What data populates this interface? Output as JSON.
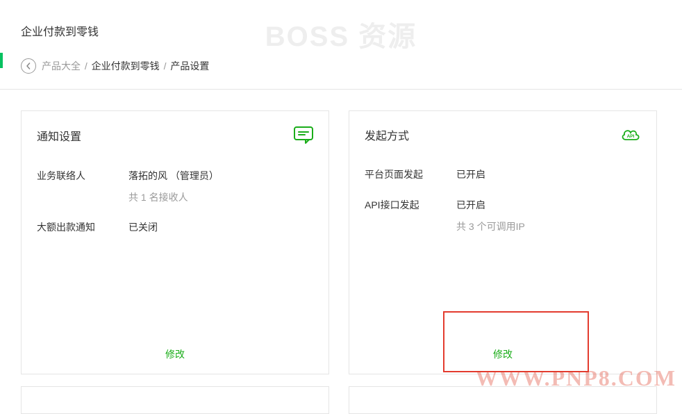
{
  "page_title": "企业付款到零钱",
  "breadcrumb": {
    "root": "产品大全",
    "mid": "企业付款到零钱",
    "current": "产品设置",
    "sep": "/"
  },
  "watermark": "BOSS 资源",
  "url_watermark": "WWW.PNP8.COM",
  "cards": {
    "notify": {
      "title": "通知设置",
      "contact_label": "业务联络人",
      "contact_value": "落拓的风 （管理员）",
      "contact_sub": "共 1 名接收人",
      "large_label": "大额出款通知",
      "large_value": "已关闭",
      "modify": "修改"
    },
    "initiate": {
      "title": "发起方式",
      "platform_label": "平台页面发起",
      "platform_value": "已开启",
      "api_label": "API接口发起",
      "api_value": "已开启",
      "api_sub": "共 3 个可调用IP",
      "modify": "修改"
    }
  }
}
